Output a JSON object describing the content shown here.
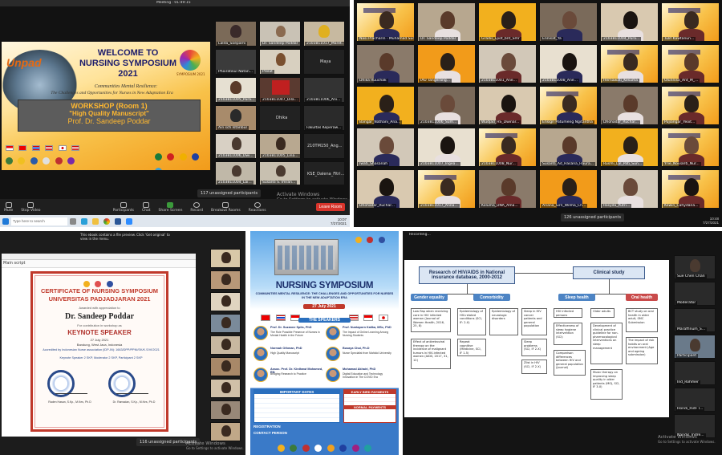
{
  "panel1": {
    "top_bar_text": "Meeting · 01:49:15",
    "banner": {
      "title_line1": "WELCOME TO",
      "title_line2": "NURSING SYMPOSIUM",
      "title_line3": "2021",
      "subtitle_line1": "Communities Mental Resilience:",
      "subtitle_line2": "The Challenges and Opportunities for Nurses in New Adaptation Era",
      "logo_left": "Unpad",
      "logo_right": "SYMPOSIUM 2021",
      "workshop": "WORKSHOP (Room 1)",
      "topic": "\"High Quality Manuscript\"",
      "speaker": "Prof. Dr. Sandeep Poddar"
    },
    "participants": [
      {
        "name": "Lalita_Soeparni"
      },
      {
        "name": "Dr. Sandeep Poddar"
      },
      {
        "name": "2103811017_Maret..."
      },
      {
        "name": "Phoiratikul Natan..."
      },
      {
        "name": "Prelat"
      },
      {
        "name": "Maya"
      },
      {
        "name": "2103811005_Pura..."
      },
      {
        "name": "2103811047_Dila..."
      },
      {
        "name": "2103811006_Ani..."
      },
      {
        "name": "Ain sch Istanbul"
      },
      {
        "name": "Dhika"
      },
      {
        "name": "Fakultas Keperaw..."
      },
      {
        "name": "2103811006_Dwi..."
      },
      {
        "name": "2103811005_Lina..."
      },
      {
        "name": "210TM150_Ang..."
      },
      {
        "name": "2103811004_Lai..."
      },
      {
        "name": "Susanti S. Imran..."
      },
      {
        "name": "KSE_Dalena_Fitri..."
      }
    ],
    "unassigned": "117 unassigned participants",
    "watermark_line1": "Activate Windows",
    "watermark_line2": "Go to Settings to activate Windows.",
    "toolbar": [
      {
        "label": "Mute"
      },
      {
        "label": "Stop Video"
      },
      {
        "label": "Participants"
      },
      {
        "label": "Chat"
      },
      {
        "label": "Share Screen"
      },
      {
        "label": "Record"
      },
      {
        "label": "Breakout Rooms"
      },
      {
        "label": "Reactions"
      }
    ],
    "leave": "Leave Room",
    "taskbar_search": "Type here to search",
    "clock": "10:07",
    "date": "7/27/2021"
  },
  "panel2": {
    "participants": [
      {
        "name": "Nasi Pracharin - Muhamad Sudhiyono"
      },
      {
        "name": "Dr. Sandeep Poddar"
      },
      {
        "name": "Gradis_Lpot_bnt_Smr"
      },
      {
        "name": "Ennisat_Ya"
      },
      {
        "name": "2103811004_Pura..."
      },
      {
        "name": "Tulit Kawtanun..."
      },
      {
        "name": "Dhika Ruuchak"
      },
      {
        "name": "IAU Tangerang..."
      },
      {
        "name": "2103811001_Ane..."
      },
      {
        "name": "2103811008_Ane..."
      },
      {
        "name": "Hernawati_Kesuma"
      },
      {
        "name": "Olunnisa_Ant_M_..."
      },
      {
        "name": "Bangar_Nathani_Ana..."
      },
      {
        "name": "2103811006_Sum..."
      },
      {
        "name": "Wudjad_HS_Dwinar..."
      },
      {
        "name": "Ensign Patumeng Ngitantha"
      },
      {
        "name": "Dhohadar_Ruchar..."
      },
      {
        "name": "Pujiangar_Yeoit..."
      },
      {
        "name": "Iwati_Shasanah"
      },
      {
        "name": "2103811007_Ingea..."
      },
      {
        "name": "2103811008_Nur..."
      },
      {
        "name": "Susanti_Ad_Hasana_Haura..."
      },
      {
        "name": "Rusmi_Lal_Pati_Sun..."
      },
      {
        "name": "Yrie_Novianti_Nur..."
      },
      {
        "name": "Dhohadar_Ruchar..."
      },
      {
        "name": "2103811017_Anna..."
      },
      {
        "name": "Koluma_DNA_Ama..."
      },
      {
        "name": "Ariana_Sirn_Wilma_Ch..."
      },
      {
        "name": "Rosyda_Putri..."
      },
      {
        "name": "Kewin_Cahydana..."
      }
    ],
    "unassigned": "126 unassigned participants",
    "clock": "10:48",
    "date": "7/27/2021"
  },
  "panel3": {
    "window_title": "Main script",
    "toolbar_hint": "This ebook contains a file preview. Click 'Get original' to view in the menu.",
    "certificate": {
      "title_line1": "CERTIFICATE OF NURSING SYMPOSIUM",
      "title_line2": "UNIVERSITAS PADJADJARAN 2021",
      "awarded_to": "Awarded with appreciation to",
      "recipient": "Dr. Sandeep Poddar",
      "for_text": "For contribution in workshop as",
      "role": "KEYNOTE SPEAKER",
      "date": "27 July 2021",
      "location": "Bandung, West Java, Indonesia",
      "accreditation1": "Accredited by Indonesian Nurse association (IDP-IN): 1663/DPP/PPNI/SK/K.S/VI/2021",
      "accreditation2": "Keynote Speaker 2 SKP, Moderator 2 SKP, Participant 2 SKP",
      "sig_left": "Raden Hasan, S.Kp., M.Kes, Ph.D",
      "sig_right": "Dr. Ramadan, S.Kp., M.Kes, Ph.D"
    },
    "unassigned": "116 unassigned participants",
    "watermark_line1": "Activate Windows",
    "watermark_line2": "Go to Settings to activate Windows."
  },
  "panel4": {
    "title": "NURSING SYMPOSIUM",
    "subtitle": "COMMUNITIES MENTAL RESILIENCE: THE CHALLENGES AND OPPORTUNITIES FOR NURSES IN THE NEW ADAPTATION ERA",
    "date": "27 July 2021",
    "speakers_heading": "THE SPEAKERS",
    "speakers": [
      {
        "name": "Prof. Dr. Suzanne Spits, PhD",
        "topic": "The Role Possible Presence of Nurses in Mental Health in the Future"
      },
      {
        "name": "Prof. Nuntaporn Kalika, MSc, PhD",
        "topic": "The Impact of Online Learning Among Nursing Students"
      },
      {
        "name": "Normah Othman, PhD",
        "topic": "High Quality Manuscript"
      },
      {
        "name": "Busaya Chai, Ph.D",
        "topic": "Nurse Specialist from Mahidol University"
      },
      {
        "name": "Assoc. Prof. Dr. Kirdhawi Mohamed, RN",
        "topic": "Bridging Research to Practice"
      },
      {
        "name": "Mohamad Akhairi, PhD",
        "topic": "Digital Education and Technology Innovation in The COVID Era"
      }
    ],
    "important_dates_heading": "IMPORTANT DATES",
    "early_bird_heading": "EARLY BIRD PAYMENTS",
    "normal_heading": "NORMAL PAYMENTS",
    "registration_label": "REGISTRATION",
    "contact_label": "CONTACT PERSON"
  },
  "panel5": {
    "window_title": "Recording...",
    "chart_title_left": "Research of HIV/AIDS in National insurance database, 2000-2012",
    "chart_title_right": "Clinical study",
    "categories": [
      "Gender equality",
      "Comorbidity",
      "Sleep health",
      "Oral health"
    ],
    "boxes": [
      "Low flap when receiving care in HIV infected woman (Journal of Women Health, 2016, 25, 8)",
      "Effect of antiretroviral therapy on the incidence of malignant tumors in HIV-infected women (AIDS, 2017, 31, 12)",
      "Epidemiology of HIV-related conditions (SCI, IF: 2.X)",
      "Epidemiology of neurologic disorders",
      "Sleep in HIV cancer patients and general population",
      "Sleep problems (SCI, IF 2.X)",
      "Repeat cognitive (Medicine, SCI, IF 1.5)",
      "Zlist in HIV (SCI, IF 2.X)",
      "HIV infected persons",
      "Older adults",
      "BCT study on oral health in older adult, SMC Submission",
      "Effectiveness of sleep hygiene intervention (SCI)",
      "Development of clinical practice guideline for non-pharmacological interventions on sleep management",
      "The impact of risk habits on oral environment (Age and ageing submission)",
      "Comparison differences between HIV and general population (Journal)",
      "Music therapy on improving sleep quality in older patients (MOJ, SCI, IF 3.X)"
    ],
    "participants": [
      {
        "name": "Sue Chen Chan"
      },
      {
        "name": "Moderator"
      },
      {
        "name": "Maraffinum_S..."
      },
      {
        "name": "Participant"
      },
      {
        "name": "Ind_Rohmer"
      },
      {
        "name": "Hondi_RidF I..."
      },
      {
        "name": "Nandis_Indre..."
      }
    ],
    "watermark_line1": "Activate Windows",
    "watermark_line2": "Go to Settings to activate Windows."
  },
  "colors": {
    "zoom_dark": "#1a1a1a",
    "banner_orange": "#f29b1a",
    "cert_red": "#c0392b",
    "poster_blue": "#2a6fbe",
    "flow_blue": "#4d84c4"
  }
}
